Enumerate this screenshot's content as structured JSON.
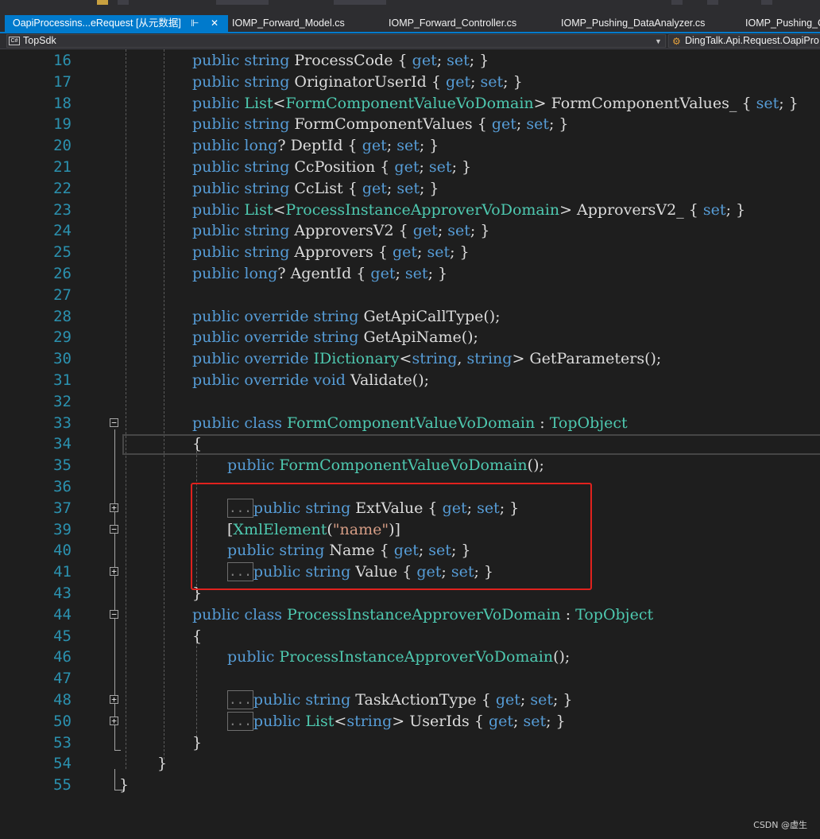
{
  "tabs": [
    {
      "label": "OapiProcessins...eRequest [从元数据]",
      "active": true,
      "pin": "pin-icon",
      "close": "close-icon"
    },
    {
      "label": "IOMP_Forward_Model.cs",
      "active": false
    },
    {
      "label": "IOMP_Forward_Controller.cs",
      "active": false
    },
    {
      "label": "IOMP_Pushing_DataAnalyzer.cs",
      "active": false
    },
    {
      "label": "IOMP_Pushing_C",
      "active": false
    }
  ],
  "navbar": {
    "project_badge": "C#",
    "project": "TopSdk",
    "type_path": "DingTalk.Api.Request.OapiPro"
  },
  "code_lines": [
    {
      "n": "16",
      "tokens": [
        [
          "kw",
          "public "
        ],
        [
          "kw",
          "string "
        ],
        [
          "nm",
          "ProcessCode "
        ],
        [
          "pn",
          "{ "
        ],
        [
          "kw",
          "get"
        ],
        [
          "pn",
          "; "
        ],
        [
          "kw",
          "set"
        ],
        [
          "pn",
          "; }"
        ]
      ]
    },
    {
      "n": "17",
      "tokens": [
        [
          "kw",
          "public "
        ],
        [
          "kw",
          "string "
        ],
        [
          "nm",
          "OriginatorUserId "
        ],
        [
          "pn",
          "{ "
        ],
        [
          "kw",
          "get"
        ],
        [
          "pn",
          "; "
        ],
        [
          "kw",
          "set"
        ],
        [
          "pn",
          "; }"
        ]
      ]
    },
    {
      "n": "18",
      "tokens": [
        [
          "kw",
          "public "
        ],
        [
          "ty",
          "List"
        ],
        [
          "pn",
          "<"
        ],
        [
          "ty",
          "FormComponentValueVoDomain"
        ],
        [
          "pn",
          "> "
        ],
        [
          "nm",
          "FormComponentValues_ "
        ],
        [
          "pn",
          "{ "
        ],
        [
          "kw",
          "set"
        ],
        [
          "pn",
          "; }"
        ]
      ]
    },
    {
      "n": "19",
      "tokens": [
        [
          "kw",
          "public "
        ],
        [
          "kw",
          "string "
        ],
        [
          "nm",
          "FormComponentValues "
        ],
        [
          "pn",
          "{ "
        ],
        [
          "kw",
          "get"
        ],
        [
          "pn",
          "; "
        ],
        [
          "kw",
          "set"
        ],
        [
          "pn",
          "; }"
        ]
      ]
    },
    {
      "n": "20",
      "tokens": [
        [
          "kw",
          "public "
        ],
        [
          "kw",
          "long"
        ],
        [
          "pn",
          "? "
        ],
        [
          "nm",
          "DeptId "
        ],
        [
          "pn",
          "{ "
        ],
        [
          "kw",
          "get"
        ],
        [
          "pn",
          "; "
        ],
        [
          "kw",
          "set"
        ],
        [
          "pn",
          "; }"
        ]
      ]
    },
    {
      "n": "21",
      "tokens": [
        [
          "kw",
          "public "
        ],
        [
          "kw",
          "string "
        ],
        [
          "nm",
          "CcPosition "
        ],
        [
          "pn",
          "{ "
        ],
        [
          "kw",
          "get"
        ],
        [
          "pn",
          "; "
        ],
        [
          "kw",
          "set"
        ],
        [
          "pn",
          "; }"
        ]
      ]
    },
    {
      "n": "22",
      "tokens": [
        [
          "kw",
          "public "
        ],
        [
          "kw",
          "string "
        ],
        [
          "nm",
          "CcList "
        ],
        [
          "pn",
          "{ "
        ],
        [
          "kw",
          "get"
        ],
        [
          "pn",
          "; "
        ],
        [
          "kw",
          "set"
        ],
        [
          "pn",
          "; }"
        ]
      ]
    },
    {
      "n": "23",
      "tokens": [
        [
          "kw",
          "public "
        ],
        [
          "ty",
          "List"
        ],
        [
          "pn",
          "<"
        ],
        [
          "ty",
          "ProcessInstanceApproverVoDomain"
        ],
        [
          "pn",
          "> "
        ],
        [
          "nm",
          "ApproversV2_ "
        ],
        [
          "pn",
          "{ "
        ],
        [
          "kw",
          "set"
        ],
        [
          "pn",
          "; }"
        ]
      ]
    },
    {
      "n": "24",
      "tokens": [
        [
          "kw",
          "public "
        ],
        [
          "kw",
          "string "
        ],
        [
          "nm",
          "ApproversV2 "
        ],
        [
          "pn",
          "{ "
        ],
        [
          "kw",
          "get"
        ],
        [
          "pn",
          "; "
        ],
        [
          "kw",
          "set"
        ],
        [
          "pn",
          "; }"
        ]
      ]
    },
    {
      "n": "25",
      "tokens": [
        [
          "kw",
          "public "
        ],
        [
          "kw",
          "string "
        ],
        [
          "nm",
          "Approvers "
        ],
        [
          "pn",
          "{ "
        ],
        [
          "kw",
          "get"
        ],
        [
          "pn",
          "; "
        ],
        [
          "kw",
          "set"
        ],
        [
          "pn",
          "; }"
        ]
      ]
    },
    {
      "n": "26",
      "tokens": [
        [
          "kw",
          "public "
        ],
        [
          "kw",
          "long"
        ],
        [
          "pn",
          "? "
        ],
        [
          "nm",
          "AgentId "
        ],
        [
          "pn",
          "{ "
        ],
        [
          "kw",
          "get"
        ],
        [
          "pn",
          "; "
        ],
        [
          "kw",
          "set"
        ],
        [
          "pn",
          "; }"
        ]
      ]
    },
    {
      "n": "27",
      "tokens": []
    },
    {
      "n": "28",
      "tokens": [
        [
          "kw",
          "public "
        ],
        [
          "kw",
          "override "
        ],
        [
          "kw",
          "string "
        ],
        [
          "mt",
          "GetApiCallType"
        ],
        [
          "pn",
          "();"
        ]
      ]
    },
    {
      "n": "29",
      "tokens": [
        [
          "kw",
          "public "
        ],
        [
          "kw",
          "override "
        ],
        [
          "kw",
          "string "
        ],
        [
          "mt",
          "GetApiName"
        ],
        [
          "pn",
          "();"
        ]
      ]
    },
    {
      "n": "30",
      "tokens": [
        [
          "kw",
          "public "
        ],
        [
          "kw",
          "override "
        ],
        [
          "ty",
          "IDictionary"
        ],
        [
          "pn",
          "<"
        ],
        [
          "kw",
          "string"
        ],
        [
          "pn",
          ", "
        ],
        [
          "kw",
          "string"
        ],
        [
          "pn",
          "> "
        ],
        [
          "mt",
          "GetParameters"
        ],
        [
          "pn",
          "();"
        ]
      ]
    },
    {
      "n": "31",
      "tokens": [
        [
          "kw",
          "public "
        ],
        [
          "kw",
          "override "
        ],
        [
          "kw",
          "void "
        ],
        [
          "mt",
          "Validate"
        ],
        [
          "pn",
          "();"
        ]
      ]
    },
    {
      "n": "32",
      "tokens": []
    },
    {
      "n": "33",
      "tokens": [
        [
          "kw",
          "public "
        ],
        [
          "kw",
          "class "
        ],
        [
          "ty",
          "FormComponentValueVoDomain "
        ],
        [
          "pn",
          ": "
        ],
        [
          "ty",
          "TopObject"
        ]
      ],
      "fold": "collapse"
    },
    {
      "n": "34",
      "tokens": [
        [
          "pn",
          "{"
        ]
      ]
    },
    {
      "n": "35",
      "tokens": [
        [
          "kw",
          "public "
        ],
        [
          "ty",
          "FormComponentValueVoDomain"
        ],
        [
          "pn",
          "();"
        ]
      ],
      "indent": 2
    },
    {
      "n": "36",
      "tokens": []
    },
    {
      "n": "37",
      "tokens": [
        [
          "box",
          "..."
        ],
        [
          "kw",
          "public "
        ],
        [
          "kw",
          "string "
        ],
        [
          "nm",
          "ExtValue "
        ],
        [
          "pn",
          "{ "
        ],
        [
          "kw",
          "get"
        ],
        [
          "pn",
          "; "
        ],
        [
          "kw",
          "set"
        ],
        [
          "pn",
          "; }"
        ]
      ],
      "indent": 2,
      "fold": "expand"
    },
    {
      "n": "39",
      "tokens": [
        [
          "pn",
          "["
        ],
        [
          "ty",
          "XmlElement"
        ],
        [
          "pn",
          "("
        ],
        [
          "str",
          "\"name\""
        ],
        [
          "pn",
          ")]"
        ]
      ],
      "indent": 2,
      "fold": "collapse"
    },
    {
      "n": "40",
      "tokens": [
        [
          "kw",
          "public "
        ],
        [
          "kw",
          "string "
        ],
        [
          "nm",
          "Name "
        ],
        [
          "pn",
          "{ "
        ],
        [
          "kw",
          "get"
        ],
        [
          "pn",
          "; "
        ],
        [
          "kw",
          "set"
        ],
        [
          "pn",
          "; }"
        ]
      ],
      "indent": 2
    },
    {
      "n": "41",
      "tokens": [
        [
          "box",
          "..."
        ],
        [
          "kw",
          "public "
        ],
        [
          "kw",
          "string "
        ],
        [
          "nm",
          "Value "
        ],
        [
          "pn",
          "{ "
        ],
        [
          "kw",
          "get"
        ],
        [
          "pn",
          "; "
        ],
        [
          "kw",
          "set"
        ],
        [
          "pn",
          "; }"
        ]
      ],
      "indent": 2,
      "fold": "expand"
    },
    {
      "n": "43",
      "tokens": [
        [
          "pn",
          "}"
        ]
      ]
    },
    {
      "n": "44",
      "tokens": [
        [
          "kw",
          "public "
        ],
        [
          "kw",
          "class "
        ],
        [
          "ty",
          "ProcessInstanceApproverVoDomain "
        ],
        [
          "pn",
          ": "
        ],
        [
          "ty",
          "TopObject"
        ]
      ],
      "fold": "collapse"
    },
    {
      "n": "45",
      "tokens": [
        [
          "pn",
          "{"
        ]
      ]
    },
    {
      "n": "46",
      "tokens": [
        [
          "kw",
          "public "
        ],
        [
          "ty",
          "ProcessInstanceApproverVoDomain"
        ],
        [
          "pn",
          "();"
        ]
      ],
      "indent": 2
    },
    {
      "n": "47",
      "tokens": []
    },
    {
      "n": "48",
      "tokens": [
        [
          "box",
          "..."
        ],
        [
          "kw",
          "public "
        ],
        [
          "kw",
          "string "
        ],
        [
          "nm",
          "TaskActionType "
        ],
        [
          "pn",
          "{ "
        ],
        [
          "kw",
          "get"
        ],
        [
          "pn",
          "; "
        ],
        [
          "kw",
          "set"
        ],
        [
          "pn",
          "; }"
        ]
      ],
      "indent": 2,
      "fold": "expand"
    },
    {
      "n": "50",
      "tokens": [
        [
          "box",
          "..."
        ],
        [
          "kw",
          "public "
        ],
        [
          "ty",
          "List"
        ],
        [
          "pn",
          "<"
        ],
        [
          "kw",
          "string"
        ],
        [
          "pn",
          "> "
        ],
        [
          "nm",
          "UserIds "
        ],
        [
          "pn",
          "{ "
        ],
        [
          "kw",
          "get"
        ],
        [
          "pn",
          "; "
        ],
        [
          "kw",
          "set"
        ],
        [
          "pn",
          "; }"
        ]
      ],
      "indent": 2,
      "fold": "expand"
    },
    {
      "n": "53",
      "tokens": [
        [
          "pn",
          "}"
        ]
      ]
    },
    {
      "n": "54",
      "tokens": [
        [
          "pn",
          "}"
        ]
      ],
      "indent": 0
    },
    {
      "n": "55",
      "tokens": [
        [
          "pn",
          "}"
        ]
      ],
      "indent": -1
    }
  ],
  "watermark": "CSDN @虚生"
}
